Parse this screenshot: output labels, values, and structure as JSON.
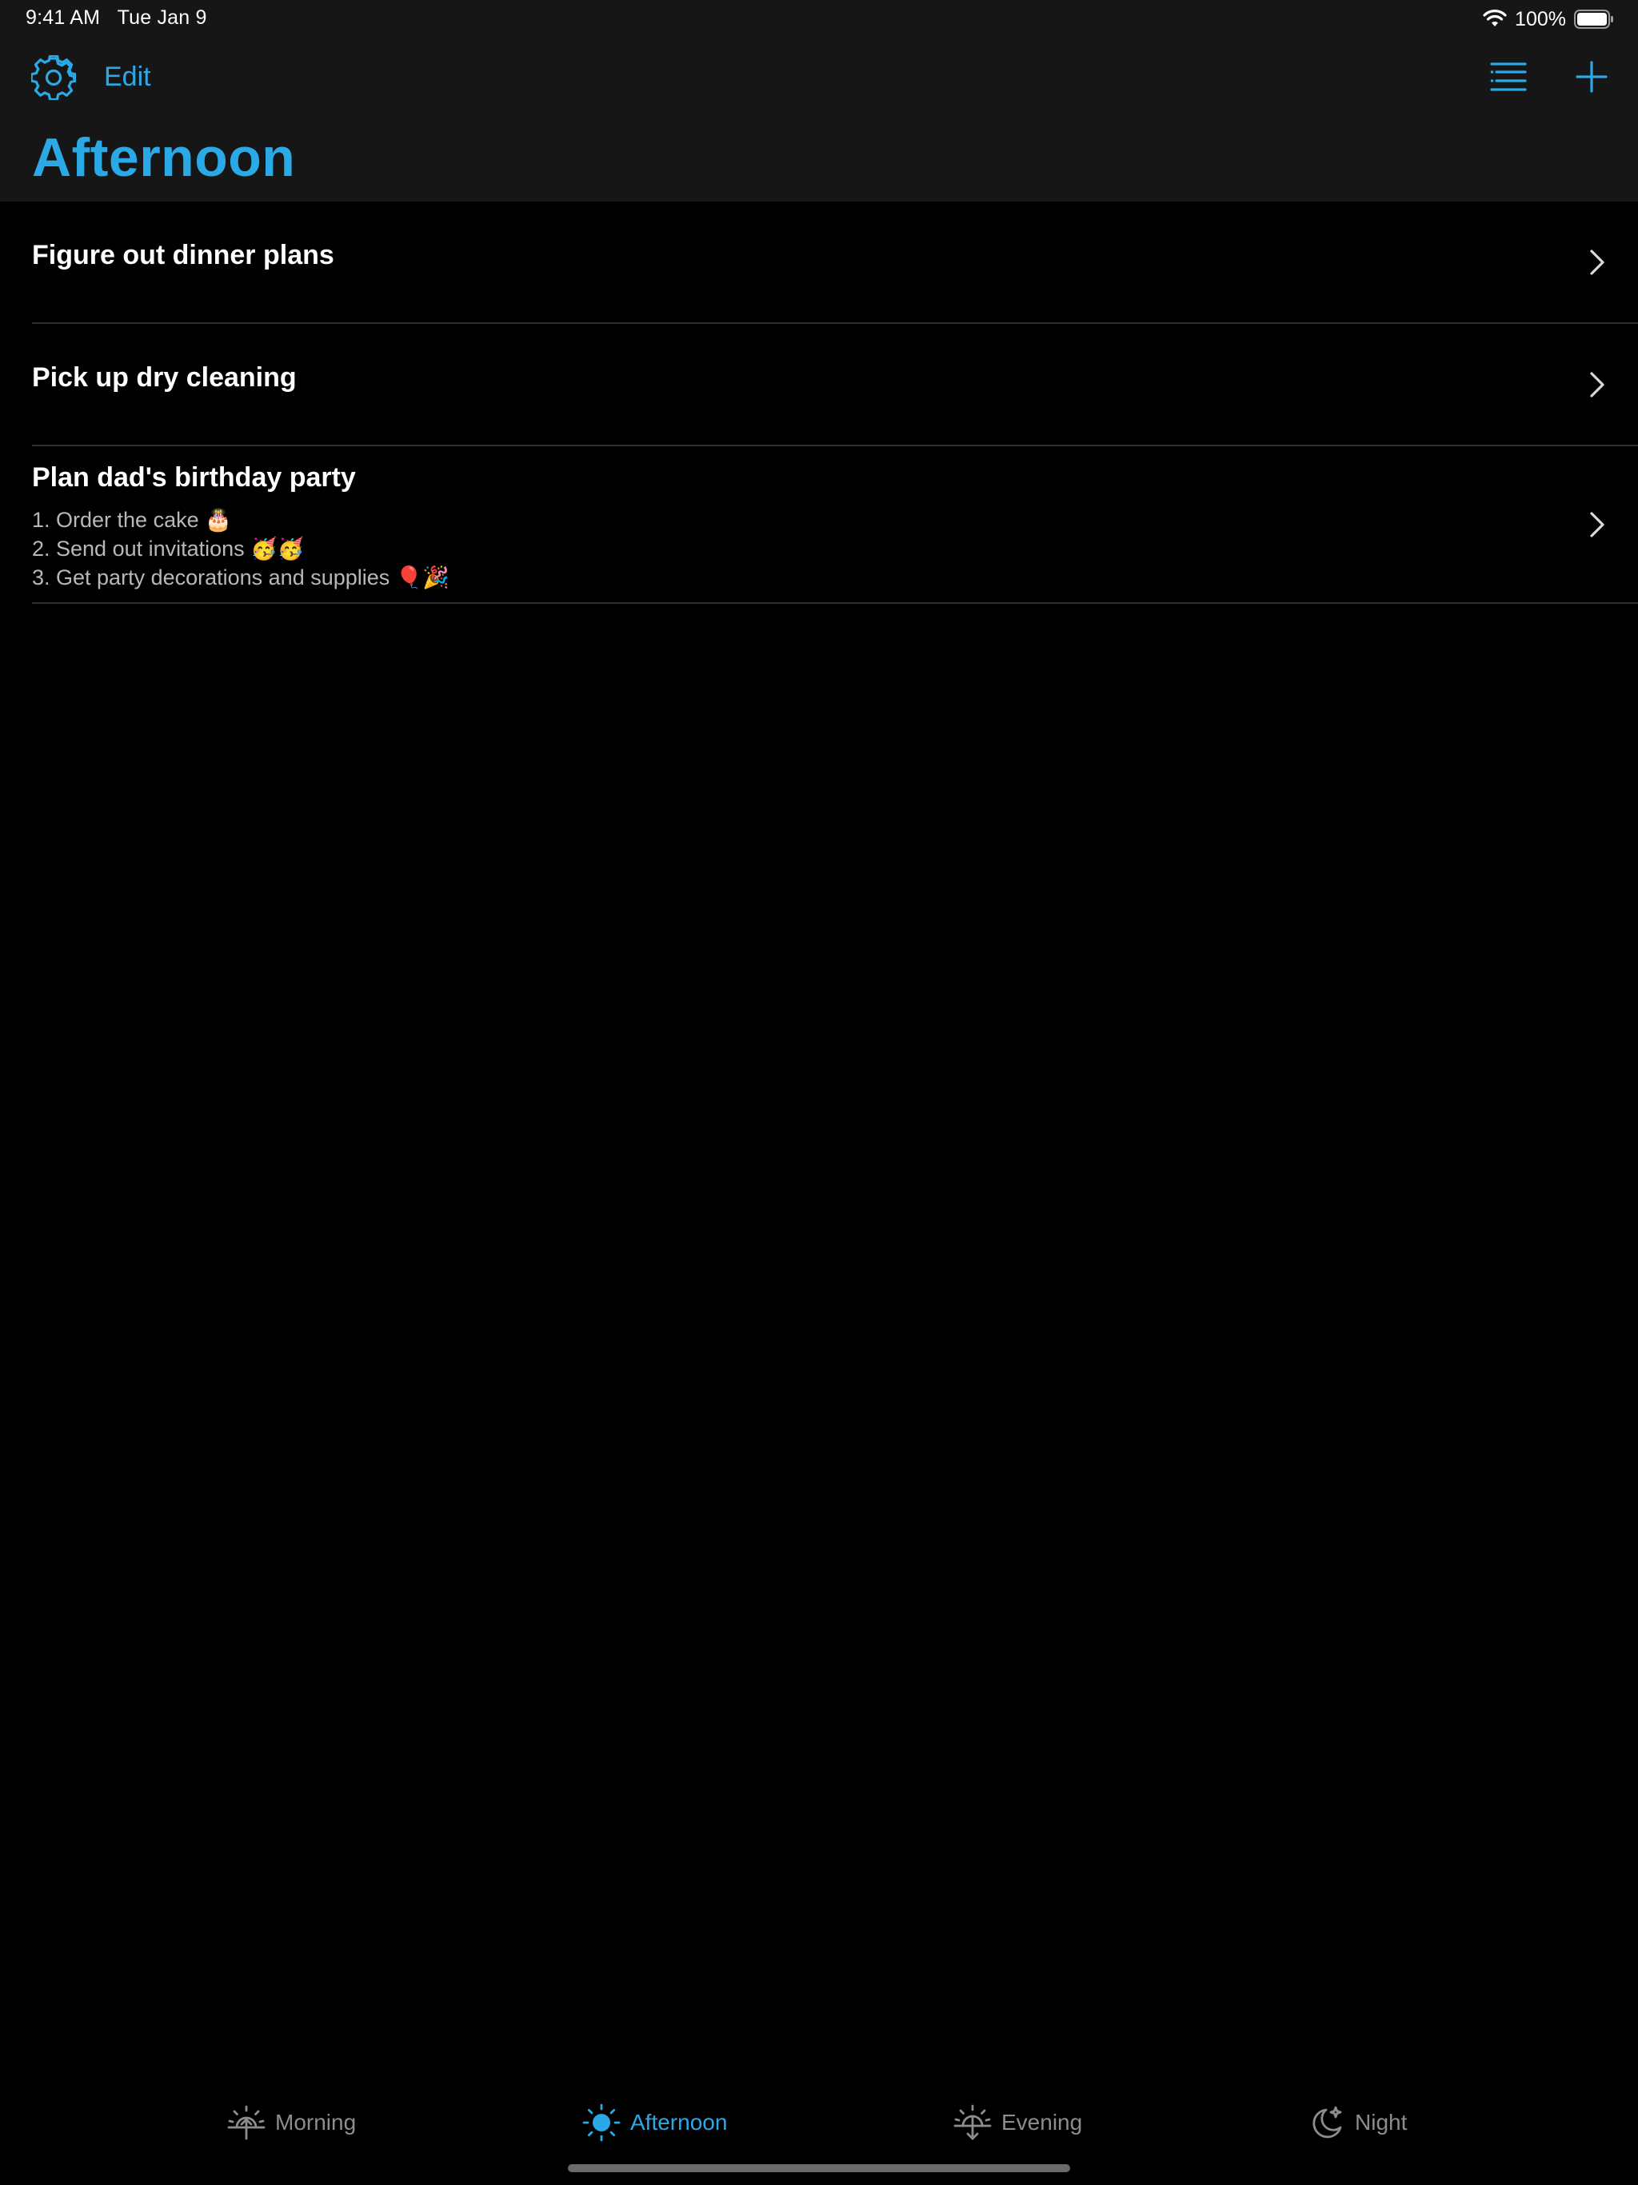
{
  "status_bar": {
    "time": "9:41 AM",
    "date": "Tue Jan 9",
    "battery_percent": "100%",
    "wifi_icon": "wifi-icon",
    "battery_icon": "battery-icon"
  },
  "nav": {
    "edit_label": "Edit",
    "title": "Afternoon",
    "settings_icon": "gear-icon",
    "list_icon": "list-icon",
    "add_icon": "plus-icon"
  },
  "items": [
    {
      "title": "Figure out dinner plans",
      "notes": []
    },
    {
      "title": "Pick up dry cleaning",
      "notes": []
    },
    {
      "title": "Plan dad's birthday party",
      "notes": [
        "1. Order the cake 🎂",
        "2. Send out invitations 🥳🥳",
        "3. Get party decorations and supplies 🎈🎉"
      ]
    }
  ],
  "tabs": [
    {
      "label": "Morning",
      "icon": "sunrise-icon",
      "active": false
    },
    {
      "label": "Afternoon",
      "icon": "sun-icon",
      "active": true
    },
    {
      "label": "Evening",
      "icon": "sunset-icon",
      "active": false
    },
    {
      "label": "Night",
      "icon": "moon-stars-icon",
      "active": false
    }
  ],
  "colors": {
    "accent": "#2aa9e6",
    "bar_background": "#161616",
    "background": "#000000",
    "inactive_tab": "#8d8d8d"
  }
}
